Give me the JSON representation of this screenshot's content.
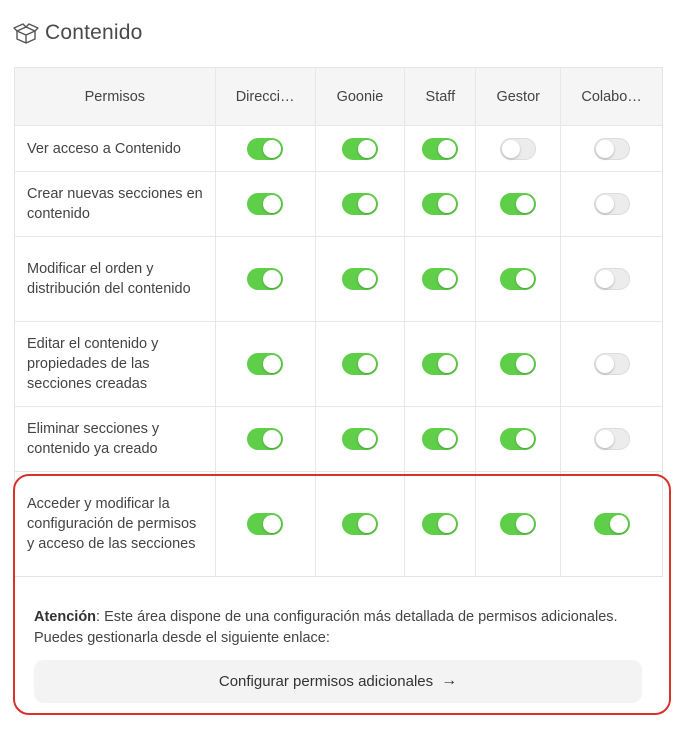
{
  "header": {
    "title": "Contenido",
    "icon": "box-icon"
  },
  "table": {
    "columns": [
      "Permisos",
      "Direcci…",
      "Goonie",
      "Staff",
      "Gestor",
      "Colabo…"
    ],
    "rows": [
      {
        "label": "Ver acceso a Contenido",
        "toggles": [
          true,
          true,
          true,
          false,
          false
        ]
      },
      {
        "label": "Crear nuevas secciones en contenido",
        "toggles": [
          true,
          true,
          true,
          true,
          false
        ]
      },
      {
        "label": "Modificar el orden y distribución del contenido",
        "toggles": [
          true,
          true,
          true,
          true,
          false
        ]
      },
      {
        "label": "Editar el contenido y propiedades de las secciones creadas",
        "toggles": [
          true,
          true,
          true,
          true,
          false
        ]
      },
      {
        "label": "Eliminar secciones y contenido ya creado",
        "toggles": [
          true,
          true,
          true,
          true,
          false
        ]
      },
      {
        "label": "Acceder y modificar la configuración de permisos y acceso de las secciones",
        "toggles": [
          true,
          true,
          true,
          true,
          true
        ]
      }
    ]
  },
  "notice": {
    "strong": "Atención",
    "text": ": Este área dispone de una configuración más detallada de permisos adicionales. Puedes gestionarla desde el siguiente enlace:"
  },
  "config_button": {
    "label": "Configurar permisos adicionales",
    "arrow": "→"
  },
  "colors": {
    "toggle_on": "#5fcf49",
    "toggle_off": "#ececec",
    "highlight": "#d9322b"
  }
}
